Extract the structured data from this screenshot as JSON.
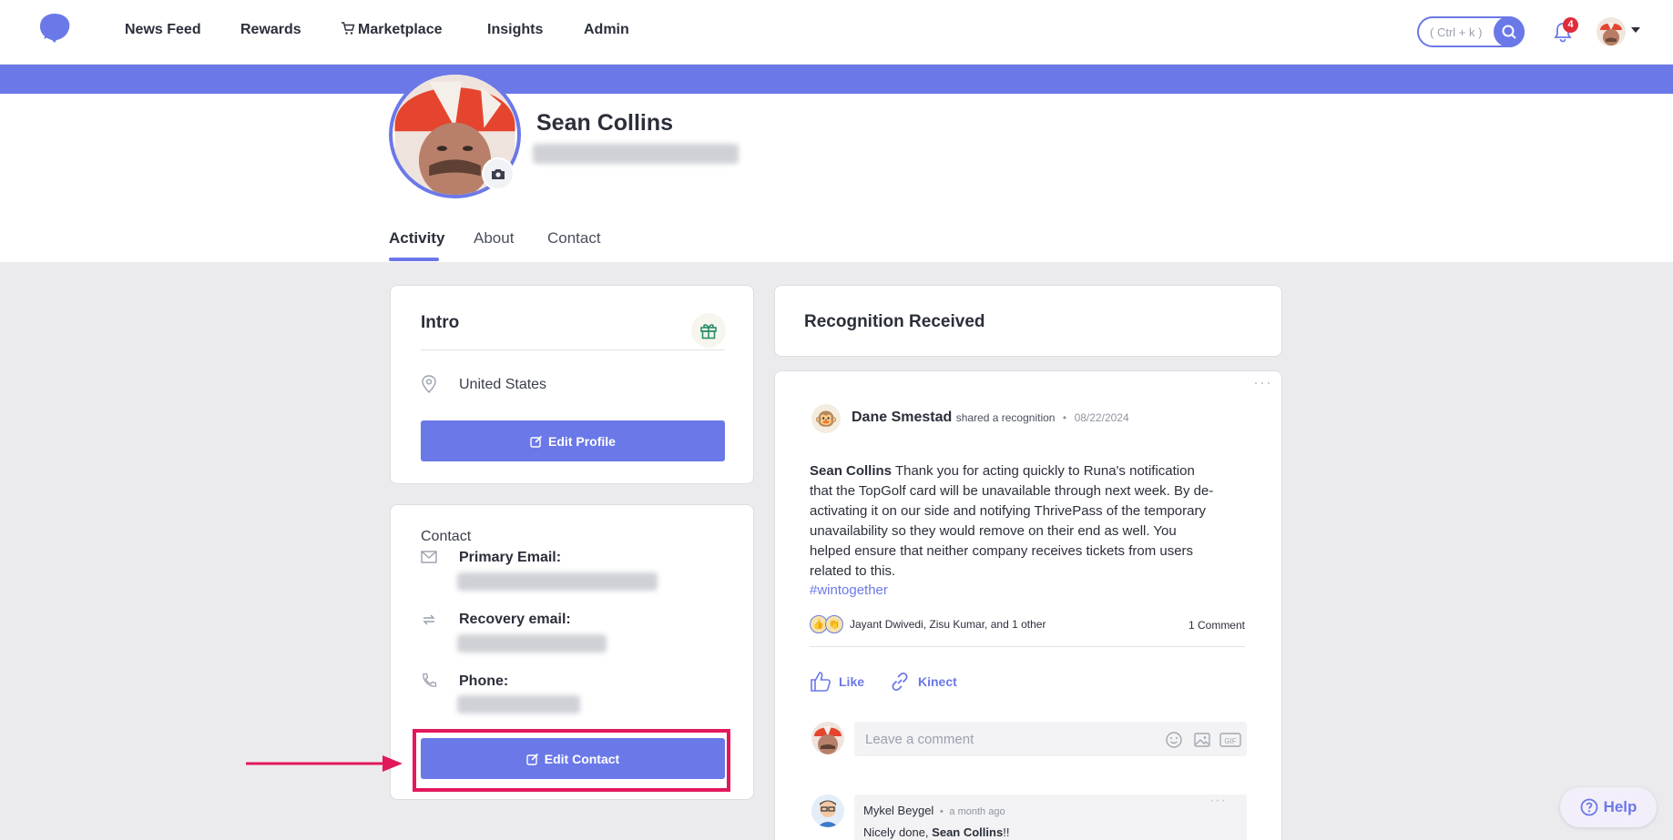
{
  "colors": {
    "accent": "#6b78e8",
    "badge": "#e02d3c",
    "highlight": "#e3185a",
    "page_bg": "#ebebee"
  },
  "nav": {
    "items": [
      {
        "label": "News Feed"
      },
      {
        "label": "Rewards"
      },
      {
        "label": "Marketplace",
        "icon": "cart-icon"
      },
      {
        "label": "Insights"
      },
      {
        "label": "Admin"
      }
    ],
    "search_hint": "( Ctrl + k )",
    "notification_count": "4"
  },
  "profile": {
    "name": "Sean Collins",
    "tabs": [
      {
        "label": "Activity"
      },
      {
        "label": "About"
      },
      {
        "label": "Contact"
      }
    ],
    "active_tab": "Activity"
  },
  "intro": {
    "title": "Intro",
    "location": "United States",
    "edit_button": "Edit Profile"
  },
  "contact": {
    "title": "Contact",
    "primary_email_label": "Primary Email:",
    "recovery_email_label": "Recovery email:",
    "phone_label": "Phone:",
    "edit_button": "Edit Contact"
  },
  "recognition": {
    "title": "Recognition Received",
    "post": {
      "author": "Dane Smestad",
      "action": "shared a recognition",
      "separator": "•",
      "date": "08/22/2024",
      "mention": "Sean Collins",
      "body": "Thank you for acting quickly to Runa's notification that the TopGolf card will be unavailable through next week. By de-activating it on our side and notifying ThrivePass of the temporary unavailability so they would remove on their end as well. You helped ensure that neither company receives tickets from users related to this.",
      "hashtag": "#wintogether",
      "reactions_text": "Jayant Dwivedi, Zisu Kumar, and 1 other",
      "comments_count": "1 Comment",
      "like_label": "Like",
      "kinect_label": "Kinect",
      "comment_placeholder": "Leave a comment",
      "reply": {
        "author": "Mykel Beygel",
        "separator": "•",
        "time": "a month ago",
        "text_prefix": "Nicely done,",
        "mention": "Sean Collins",
        "text_suffix": "!!"
      }
    }
  },
  "help_label": "Help"
}
